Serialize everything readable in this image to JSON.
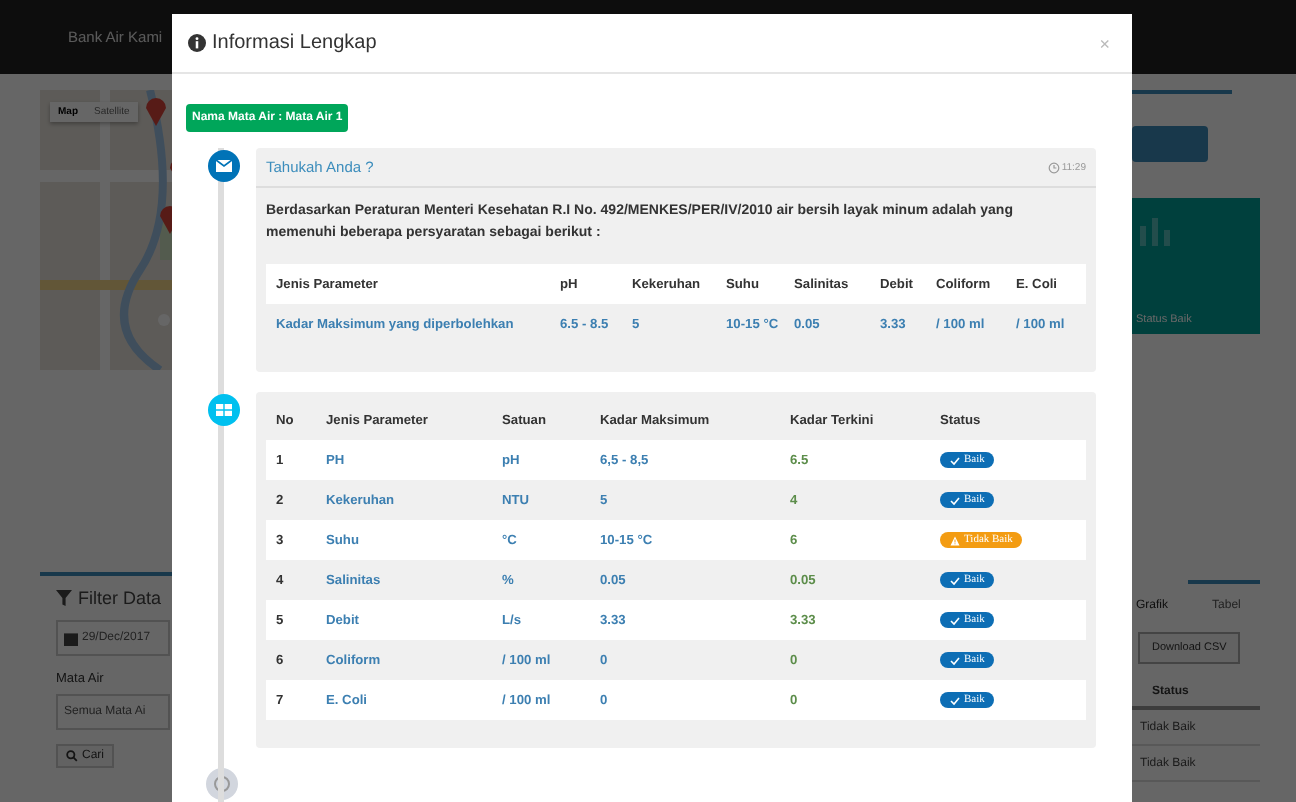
{
  "background": {
    "brand": "Bank Air Kami",
    "map": {
      "buttons": [
        {
          "label": "Map",
          "selected": true
        },
        {
          "label": "Satellite",
          "selected": false
        }
      ]
    },
    "filter": {
      "title": "Filter Data",
      "date": "29/Dec/2017",
      "field_label": "Mata Air",
      "select": "Semua Mata Ai",
      "button": "Cari"
    },
    "summary_card": {
      "label": "Status Baik"
    },
    "view_tabs": [
      {
        "label": "Grafik",
        "selected": true
      },
      {
        "label": "Tabel",
        "selected": false
      }
    ],
    "download_button": "Download CSV",
    "status_table": {
      "column": "Status",
      "rows": [
        "Tidak Baik",
        "Tidak Baik"
      ]
    }
  },
  "modal": {
    "title": "Informasi Lengkap",
    "close": "×",
    "spring_badge": "Nama Mata Air : Mata Air 1",
    "info_card": {
      "title": "Tahukah Anda ?",
      "time": "11:29",
      "text": "Berdasarkan Peraturan Menteri Kesehatan R.I No. 492/MENKES/PER/IV/2010 air bersih layak minum adalah yang memenuhi beberapa persyaratan sebagai berikut :",
      "table": {
        "columns": [
          "Jenis Parameter",
          "pH",
          "Kekeruhan",
          "Suhu",
          "Salinitas",
          "Debit",
          "Coliform",
          "E. Coli"
        ],
        "rows": [
          [
            "Kadar Maksimum yang diperbolehkan",
            "6.5 - 8.5",
            "5",
            "10-15 °C",
            "0.05",
            "3.33",
            "/ 100 ml",
            "/ 100 ml"
          ]
        ]
      }
    },
    "param_table": {
      "columns": [
        "No",
        "Jenis Parameter",
        "Satuan",
        "Kadar Maksimum",
        "Kadar Terkini",
        "Status"
      ],
      "rows": [
        {
          "no": "1",
          "parameter": "PH",
          "unit": "pH",
          "max": "6,5 - 8,5",
          "current": "6.5",
          "status": {
            "label": "Baik",
            "kind": "good"
          }
        },
        {
          "no": "2",
          "parameter": "Kekeruhan",
          "unit": "NTU",
          "max": "5",
          "current": "4",
          "status": {
            "label": "Baik",
            "kind": "good"
          }
        },
        {
          "no": "3",
          "parameter": "Suhu",
          "unit": "°C",
          "max": "10-15 °C",
          "current": "6",
          "status": {
            "label": "Tidak Baik",
            "kind": "bad"
          }
        },
        {
          "no": "4",
          "parameter": "Salinitas",
          "unit": "%",
          "max": "0.05",
          "current": "0.05",
          "status": {
            "label": "Baik",
            "kind": "good"
          }
        },
        {
          "no": "5",
          "parameter": "Debit",
          "unit": "L/s",
          "max": "3.33",
          "current": "3.33",
          "status": {
            "label": "Baik",
            "kind": "good"
          }
        },
        {
          "no": "6",
          "parameter": "Coliform",
          "unit": "/ 100 ml",
          "max": "0",
          "current": "0",
          "status": {
            "label": "Baik",
            "kind": "good"
          }
        },
        {
          "no": "7",
          "parameter": "E. Coli",
          "unit": "/ 100 ml",
          "max": "0",
          "current": "0",
          "status": {
            "label": "Baik",
            "kind": "good"
          }
        }
      ]
    }
  }
}
